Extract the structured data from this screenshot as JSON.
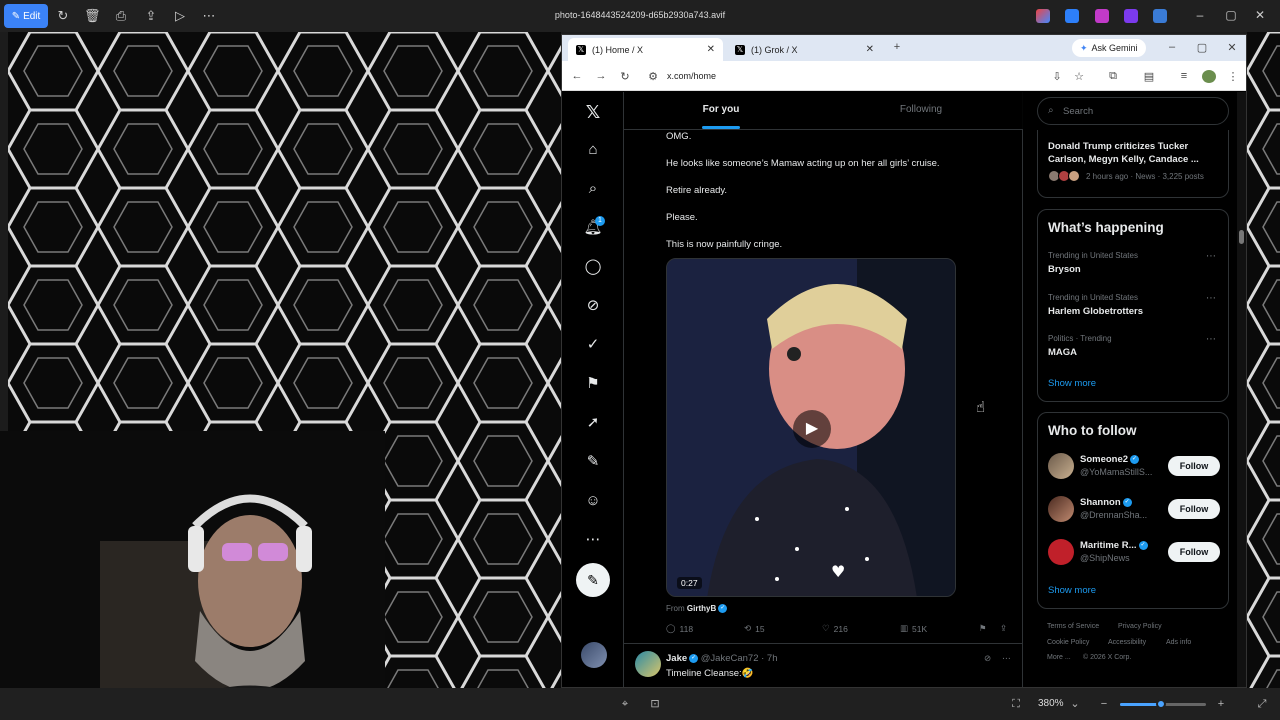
{
  "photos_app": {
    "edit_label": "Edit",
    "file_title": "photo-1648443524209-d65b2930a743.avif",
    "zoom": "380%",
    "zoom_level": 0.48
  },
  "browser": {
    "tabs": [
      {
        "label": "(1) Home / X",
        "active": true
      },
      {
        "label": "(1) Grok / X",
        "active": false
      }
    ],
    "ask_gemini": "Ask Gemini",
    "url": "x.com/home"
  },
  "feed": {
    "tab_for_you": "For you",
    "tab_following": "Following",
    "post_lines": [
      "OMG.",
      "He looks like someone’s Mamaw acting up on her all girls’ cruise.",
      "Retire already.",
      "Please.",
      "This is now painfully cringe."
    ],
    "video_duration": "0:27",
    "from_prefix": "From",
    "from_user": "GirthyB",
    "replies": "118",
    "reposts": "15",
    "likes": "216",
    "views": "51K",
    "next_post": {
      "name": "Jake",
      "handle": "@JakeCan72 · 7h",
      "text": "Timeline Cleanse:🤣"
    }
  },
  "sidebar": {
    "search_placeholder": "Search",
    "news": {
      "title": "Donald Trump criticizes Tucker Carlson, Megyn Kelly, Candace ...",
      "meta": "2 hours ago · News · 3,225 posts"
    },
    "whats_happening": {
      "heading": "What’s happening",
      "trends": [
        {
          "context": "Trending in United States",
          "name": "Bryson"
        },
        {
          "context": "Trending in United States",
          "name": "Harlem Globetrotters"
        },
        {
          "context": "Politics · Trending",
          "name": "MAGA"
        }
      ],
      "show_more": "Show more"
    },
    "who_to_follow": {
      "heading": "Who to follow",
      "accounts": [
        {
          "name": "Someone2",
          "handle": "@YoMamaStillS...",
          "button": "Follow"
        },
        {
          "name": "Shannon",
          "handle": "@DrennanSha...",
          "button": "Follow"
        },
        {
          "name": "Maritime R...",
          "handle": "@ShipNews",
          "button": "Follow"
        }
      ],
      "show_more": "Show more"
    },
    "footer": [
      "Terms of Service",
      "Privacy Policy",
      "Cookie Policy",
      "Accessibility",
      "Ads info",
      "More ...",
      "© 2026 X Corp."
    ]
  },
  "colors": {
    "accent": "#1d9bf0",
    "background": "#000000",
    "border": "#2f3336",
    "muted": "#71767b"
  }
}
